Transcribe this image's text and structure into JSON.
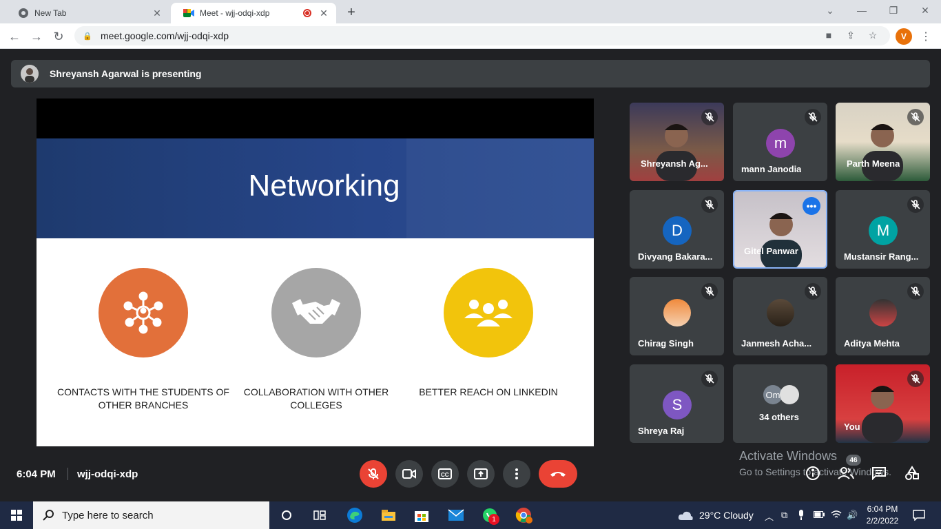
{
  "browser": {
    "tabs": [
      {
        "title": "New Tab"
      },
      {
        "title": "Meet - wjj-odqi-xdp"
      }
    ],
    "url": "meet.google.com/wjj-odqi-xdp",
    "profile_initial": "V"
  },
  "meet": {
    "presenter_banner": "Shreyansh Agarwal is presenting",
    "slide": {
      "title": "Networking",
      "items": [
        {
          "caption": "CONTACTS WITH THE STUDENTS OF OTHER BRANCHES",
          "color": "#e2703a"
        },
        {
          "caption": "COLLABORATION WITH OTHER COLLEGES",
          "color": "#a6a6a6"
        },
        {
          "caption": "BETTER REACH ON LINKEDIN",
          "color": "#f2c40c"
        }
      ]
    },
    "participants": [
      {
        "name": "Shreyansh Ag...",
        "type": "video"
      },
      {
        "name": "mann Janodia",
        "type": "letter",
        "letter": "m",
        "color": "#8e44ad"
      },
      {
        "name": "Parth Meena",
        "type": "video"
      },
      {
        "name": "Divyang Bakara...",
        "type": "letter",
        "letter": "D",
        "color": "#1565c0"
      },
      {
        "name": "Gitel Panwar",
        "type": "video"
      },
      {
        "name": "Mustansir Rang...",
        "type": "letter",
        "letter": "M",
        "color": "#00a3a3"
      },
      {
        "name": "Chirag Singh",
        "type": "photo"
      },
      {
        "name": "Janmesh Acha...",
        "type": "photo"
      },
      {
        "name": "Aditya Mehta",
        "type": "photo"
      },
      {
        "name": "Shreya Raj",
        "type": "letter",
        "letter": "S",
        "color": "#7e57c2"
      },
      {
        "name": "34 others",
        "type": "others",
        "avatar_text": "Om"
      },
      {
        "name": "You",
        "type": "video"
      }
    ],
    "time": "6:04 PM",
    "meeting_code": "wjj-odqi-xdp",
    "participants_count": "46",
    "watermark_title": "Activate Windows",
    "watermark_sub": "Go to Settings to activate Windows."
  },
  "taskbar": {
    "search_placeholder": "Type here to search",
    "weather": "29°C  Cloudy",
    "time": "6:04 PM",
    "date": "2/2/2022",
    "whatsapp_badge": "1"
  }
}
